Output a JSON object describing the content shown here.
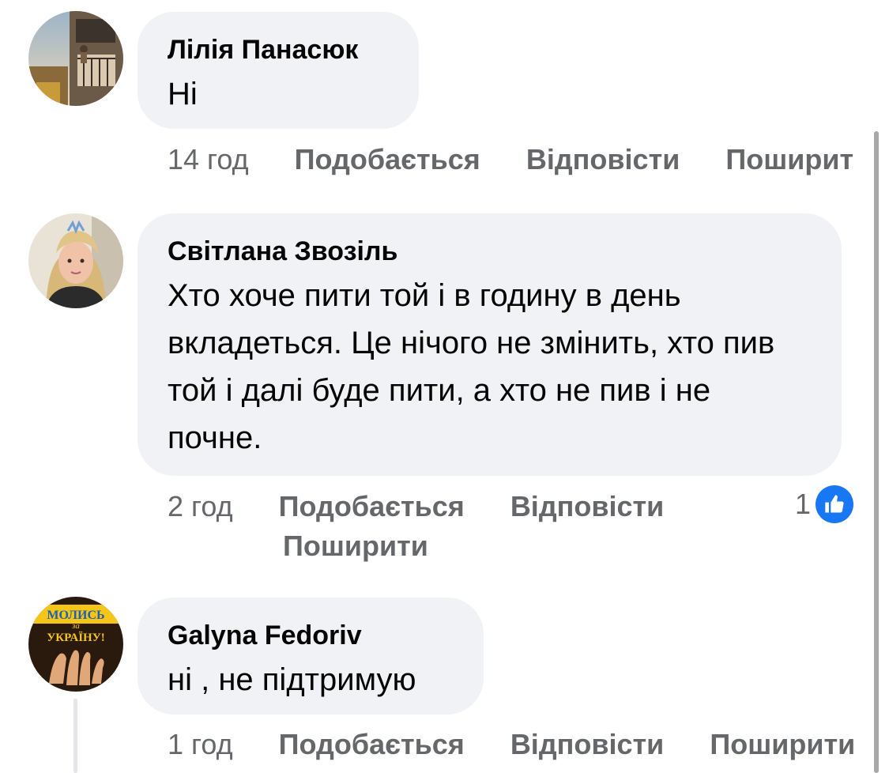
{
  "comments": [
    {
      "author": "Лілія Панасюк",
      "text": "Ні",
      "time": "14 год",
      "like_label": "Подобається",
      "reply_label": "Відповісти",
      "share_label": "Поширит",
      "avatar_icon": "photo-balcony-avatar"
    },
    {
      "author": "Світлана Звозіль",
      "text": "Хто хоче пити той і в годину в день вкладеться. Це нічого не змінить, хто пив той і далі буде пити, а хто не пив і не почне.",
      "time": "2 год",
      "like_label": "Подобається",
      "reply_label": "Відповісти",
      "share_label": "Поширити",
      "reaction_count": "1",
      "reaction_icon": "like-icon",
      "avatar_icon": "photo-woman-avatar"
    },
    {
      "author": "Galyna Fedoriv",
      "text": "ні , не підтримую",
      "time": "1 год",
      "like_label": "Подобається",
      "reply_label": "Відповісти",
      "share_label": "Поширити",
      "avatar_icon": "prayer-hands-avatar",
      "avatar_text_top": "МОЛИСЬ",
      "avatar_text_mid": "за",
      "avatar_text_bottom": "УКРАЇНУ!"
    }
  ],
  "colors": {
    "bubble_bg": "#f0f2f5",
    "meta_text": "#65676b",
    "like_blue": "#1877f2",
    "avatar_banner": "#f5c518"
  }
}
